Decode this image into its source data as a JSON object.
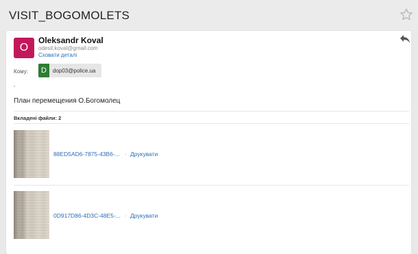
{
  "header": {
    "subject": "VISIT_BOGOMOLETS",
    "star_icon": "star-outline-icon"
  },
  "message": {
    "sender": {
      "initial": "O",
      "name": "Oleksandr Koval",
      "email": "odesit.koval@gmail.com",
      "hide_details": "Сховати деталі",
      "avatar_color": "#c2185b"
    },
    "reply_icon": "reply-icon",
    "to_label": "Кому:",
    "recipient": {
      "initial": "D",
      "email": "dop03@police.ua",
      "avatar_color": "#2e7d32"
    },
    "body": "План перемещения О.Богомолец",
    "attachments_label": "Вкладені файли: 2",
    "attachments": [
      {
        "filename": "88ED5AD6-7875-43B6-...",
        "separator": "·",
        "print_label": "Друкувати"
      },
      {
        "filename": "0D917D86-4D3C-48E5-...",
        "separator": "·",
        "print_label": "Друкувати"
      }
    ]
  },
  "colors": {
    "link": "#2a6ebb",
    "background": "#e9e9e9"
  }
}
